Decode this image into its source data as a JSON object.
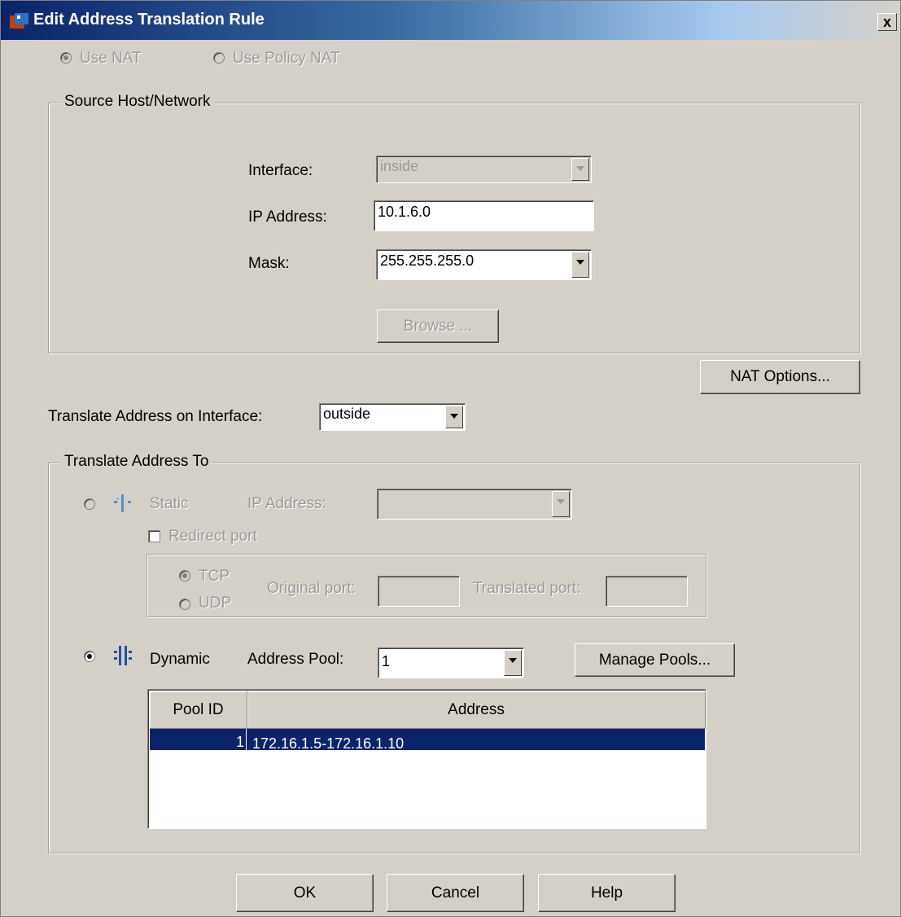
{
  "window": {
    "title": "Edit Address Translation Rule",
    "close_glyph": "x"
  },
  "nat_mode": {
    "use_nat": "Use NAT",
    "use_policy_nat": "Use Policy NAT",
    "selected": "use_nat"
  },
  "source": {
    "legend": "Source Host/Network",
    "interface_label": "Interface:",
    "interface_value": "inside",
    "ip_label": "IP Address:",
    "ip_value": "10.1.6.0",
    "mask_label": "Mask:",
    "mask_value": "255.255.255.0",
    "browse_label": "Browse ..."
  },
  "nat_options_label": "NAT Options...",
  "translate_interface": {
    "label": "Translate Address on Interface:",
    "value": "outside"
  },
  "translate_to": {
    "legend": "Translate Address To",
    "static_label": "Static",
    "static_ip_label": "IP Address:",
    "redirect_port_label": "Redirect port",
    "tcp_label": "TCP",
    "udp_label": "UDP",
    "original_port_label": "Original port:",
    "translated_port_label": "Translated port:",
    "dynamic_label": "Dynamic",
    "address_pool_label": "Address Pool:",
    "address_pool_value": "1",
    "manage_pools_label": "Manage Pools..."
  },
  "pool_table": {
    "columns": [
      "Pool ID",
      "Address"
    ],
    "rows": [
      {
        "pool_id": "1",
        "address": "172.16.1.5-172.16.1.10"
      }
    ]
  },
  "buttons": {
    "ok": "OK",
    "cancel": "Cancel",
    "help": "Help"
  },
  "icons": {
    "title": "app-icon",
    "static": "static-nat-icon",
    "dynamic": "dynamic-nat-icon"
  }
}
